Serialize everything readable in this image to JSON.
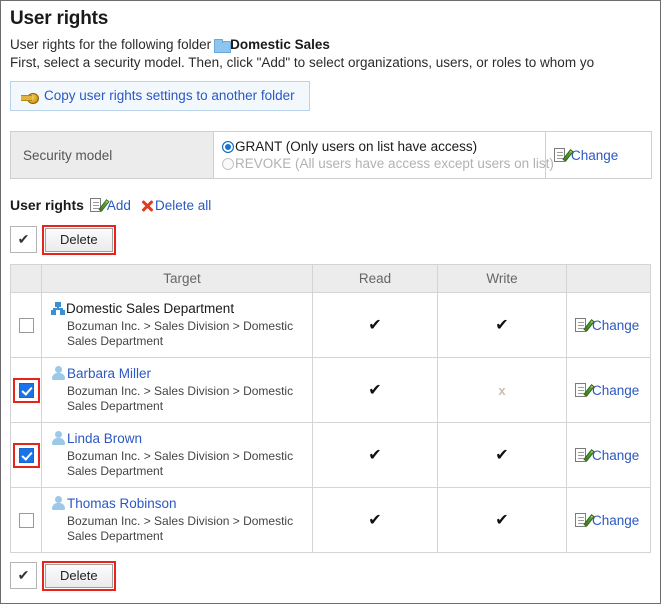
{
  "page": {
    "title": "User rights",
    "description_line1_prefix": "User rights for the following folder",
    "folder_name": "Domestic Sales",
    "description_line2": "First, select a security model. Then, click \"Add\" to select organizations, users, or roles to whom yo",
    "copy_settings_label": "Copy user rights settings to another folder"
  },
  "security_model": {
    "label": "Security model",
    "options": [
      {
        "id": "grant",
        "label": "GRANT (Only users on list have access)",
        "selected": true,
        "enabled": true
      },
      {
        "id": "revoke",
        "label": "REVOKE (All users have access except users on list)",
        "selected": false,
        "enabled": false
      }
    ],
    "change_label": "Change"
  },
  "user_rights": {
    "section_title": "User rights",
    "add_label": "Add",
    "delete_all_label": "Delete all",
    "delete_button_label": "Delete",
    "select_all_mark": "✔",
    "columns": {
      "checkbox": "",
      "target": "Target",
      "read": "Read",
      "write": "Write",
      "action": ""
    },
    "rows": [
      {
        "type": "organization",
        "icon": "org-chart-icon",
        "name": "Domestic Sales Department",
        "path": "Bozuman Inc. > Sales Division > Domestic Sales Department",
        "checked": false,
        "highlighted": false,
        "read": "✔",
        "write": "✔",
        "read_granted": true,
        "write_granted": true,
        "change_label": "Change"
      },
      {
        "type": "user",
        "icon": "person-icon",
        "name": "Barbara Miller",
        "path": "Bozuman Inc. > Sales Division > Domestic Sales Department",
        "checked": true,
        "highlighted": true,
        "read": "✔",
        "write": "x",
        "read_granted": true,
        "write_granted": false,
        "change_label": "Change"
      },
      {
        "type": "user",
        "icon": "person-icon",
        "name": "Linda Brown",
        "path": "Bozuman Inc. > Sales Division > Domestic Sales Department",
        "checked": true,
        "highlighted": true,
        "read": "✔",
        "write": "✔",
        "read_granted": true,
        "write_granted": true,
        "change_label": "Change"
      },
      {
        "type": "user",
        "icon": "person-icon",
        "name": "Thomas Robinson",
        "path": "Bozuman Inc. > Sales Division > Domestic Sales Department",
        "checked": false,
        "highlighted": false,
        "read": "✔",
        "write": "✔",
        "read_granted": true,
        "write_granted": true,
        "change_label": "Change"
      }
    ]
  },
  "colors": {
    "link": "#2b58c2",
    "highlight_outline": "#e8231a",
    "checkbox_checked": "#1a73e8",
    "header_bg": "#ececec",
    "folder_icon": "#8ec5ef"
  }
}
